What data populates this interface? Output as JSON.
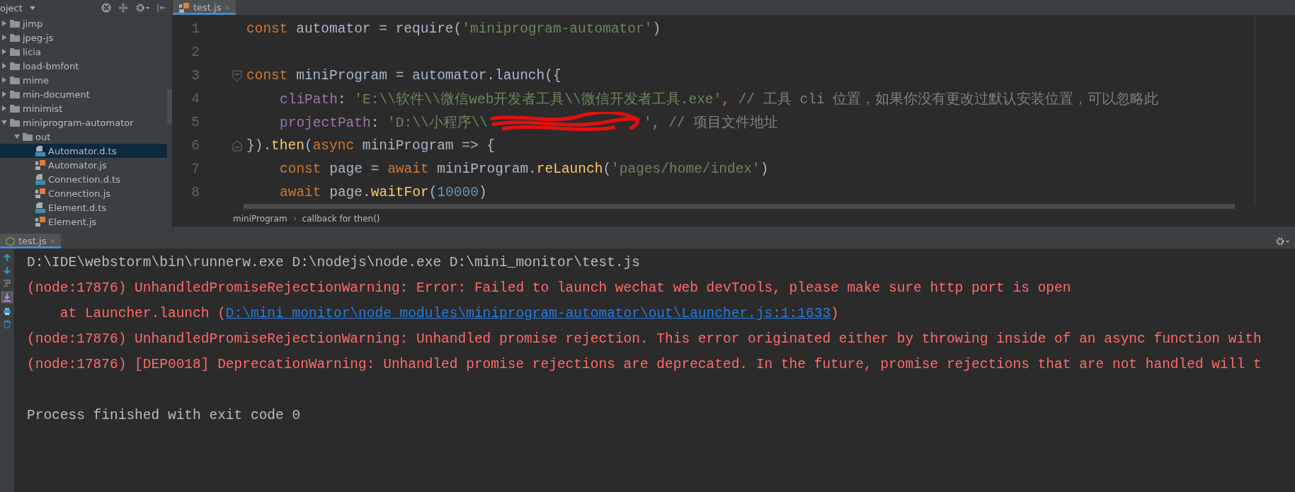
{
  "project_panel": {
    "title": "oject",
    "tree": [
      {
        "label": "jimp",
        "kind": "folder",
        "expanded": false,
        "selected": false
      },
      {
        "label": "jpeg-js",
        "kind": "folder",
        "expanded": false,
        "selected": false
      },
      {
        "label": "licia",
        "kind": "folder",
        "expanded": false,
        "selected": false
      },
      {
        "label": "load-bmfont",
        "kind": "folder",
        "expanded": false,
        "selected": false
      },
      {
        "label": "mime",
        "kind": "folder",
        "expanded": false,
        "selected": false
      },
      {
        "label": "min-document",
        "kind": "folder",
        "expanded": false,
        "selected": false
      },
      {
        "label": "minimist",
        "kind": "folder",
        "expanded": false,
        "selected": false
      },
      {
        "label": "miniprogram-automator",
        "kind": "folder",
        "expanded": true,
        "selected": false,
        "children": [
          {
            "label": "out",
            "kind": "folder",
            "expanded": true,
            "selected": false,
            "children": [
              {
                "label": "Automator.d.ts",
                "kind": "ts",
                "selected": true
              },
              {
                "label": "Automator.js",
                "kind": "js",
                "selected": false
              },
              {
                "label": "Connection.d.ts",
                "kind": "ts",
                "selected": false
              },
              {
                "label": "Connection.js",
                "kind": "js",
                "selected": false
              },
              {
                "label": "Element.d.ts",
                "kind": "ts",
                "selected": false
              },
              {
                "label": "Element.js",
                "kind": "js",
                "selected": false
              }
            ]
          }
        ]
      }
    ]
  },
  "editor": {
    "tabs": [
      {
        "label": "test.js",
        "selected": true
      }
    ],
    "lines": [
      {
        "number": "1",
        "indented": false,
        "fold_start": false,
        "fold_end": false,
        "tokens": [
          {
            "kind": "keyword",
            "text": "const"
          },
          {
            "kind": "plain",
            "text": " automator = require("
          },
          {
            "kind": "string",
            "text": "'miniprogram-automator'"
          },
          {
            "kind": "plain",
            "text": ")"
          }
        ]
      },
      {
        "number": "2",
        "fold_start": false,
        "fold_end": false
      },
      {
        "number": "3",
        "indented": false,
        "fold_start": true,
        "fold_end": false,
        "tokens": [
          {
            "kind": "keyword",
            "text": "const"
          },
          {
            "kind": "plain",
            "text": " miniProgram = automator.launch({"
          }
        ]
      },
      {
        "number": "4",
        "indented": true,
        "fold_start": false,
        "fold_end": false,
        "tokens": [
          {
            "kind": "prop",
            "text": "cliPath"
          },
          {
            "kind": "plain",
            "text": ": "
          },
          {
            "kind": "string",
            "text": "'E:\\\\软件\\\\微信web开发者工具\\\\微信开发者工具.exe'"
          },
          {
            "kind": "keyword",
            "text": ","
          },
          {
            "kind": "comment",
            "text": " // 工具 cli 位置，如果你没有更改过默认安装位置，可以忽略此"
          }
        ]
      },
      {
        "number": "5",
        "indented": true,
        "fold_start": false,
        "fold_end": false,
        "tokens": [
          {
            "kind": "prop",
            "text": "projectPath"
          },
          {
            "kind": "plain",
            "text": ": "
          },
          {
            "kind": "string",
            "text": "'D:\\\\小程序\\\\"
          },
          {
            "kind": "redaction"
          },
          {
            "kind": "string",
            "text": "'"
          },
          {
            "kind": "keyword",
            "text": ","
          },
          {
            "kind": "comment",
            "text": " // 项目文件地址"
          }
        ]
      },
      {
        "number": "6",
        "indented": false,
        "fold_start": false,
        "fold_end": true,
        "tokens": [
          {
            "kind": "plain",
            "text": "})."
          },
          {
            "kind": "func",
            "text": "then"
          },
          {
            "kind": "plain",
            "text": "("
          },
          {
            "kind": "keyword",
            "text": "async"
          },
          {
            "kind": "plain",
            "text": " miniProgram => {"
          }
        ]
      },
      {
        "number": "7",
        "indented": true,
        "fold_start": false,
        "fold_end": false,
        "tokens": [
          {
            "kind": "keyword",
            "text": "const"
          },
          {
            "kind": "plain",
            "text": " page = "
          },
          {
            "kind": "keyword",
            "text": "await"
          },
          {
            "kind": "plain",
            "text": " miniProgram."
          },
          {
            "kind": "func",
            "text": "reLaunch"
          },
          {
            "kind": "plain",
            "text": "("
          },
          {
            "kind": "string",
            "text": "'pages/home/index'"
          },
          {
            "kind": "plain",
            "text": ")"
          }
        ]
      },
      {
        "number": "8",
        "indented": true,
        "fold_start": false,
        "fold_end": false,
        "tokens": [
          {
            "kind": "keyword",
            "text": "await"
          },
          {
            "kind": "plain",
            "text": " page."
          },
          {
            "kind": "func",
            "text": "waitFor"
          },
          {
            "kind": "plain",
            "text": "("
          },
          {
            "kind": "number",
            "text": "10000"
          },
          {
            "kind": "plain",
            "text": ")"
          }
        ]
      }
    ],
    "breadcrumbs": [
      "miniProgram",
      "callback for then()"
    ]
  },
  "run_panel": {
    "tabs": [
      {
        "label": "test.js",
        "selected": true
      }
    ],
    "lines": [
      {
        "kind": "command",
        "segments": [
          {
            "kind": "text",
            "text": "D:\\IDE\\webstorm\\bin\\runnerw.exe D:\\nodejs\\node.exe D:\\mini_monitor\\test.js"
          }
        ]
      },
      {
        "kind": "error",
        "segments": [
          {
            "kind": "text",
            "text": "(node:17876) UnhandledPromiseRejectionWarning: Error: Failed to launch wechat web devTools, please make sure http port is open"
          }
        ]
      },
      {
        "kind": "error",
        "segments": [
          {
            "kind": "text",
            "text": "    at Launcher.launch ("
          },
          {
            "kind": "link",
            "text": "D:\\mini_monitor\\node_modules\\miniprogram-automator\\out\\Launcher.js:1:1633"
          },
          {
            "kind": "text",
            "text": ")"
          }
        ]
      },
      {
        "kind": "error",
        "segments": [
          {
            "kind": "text",
            "text": "(node:17876) UnhandledPromiseRejectionWarning: Unhandled promise rejection. This error originated either by throwing inside of an async function with"
          }
        ]
      },
      {
        "kind": "error",
        "segments": [
          {
            "kind": "text",
            "text": "(node:17876) [DEP0018] DeprecationWarning: Unhandled promise rejections are deprecated. In the future, promise rejections that are not handled will t"
          }
        ]
      },
      {
        "kind": "status",
        "segments": [
          {
            "kind": "text",
            "text": "Process finished with exit code 0"
          }
        ]
      }
    ]
  }
}
